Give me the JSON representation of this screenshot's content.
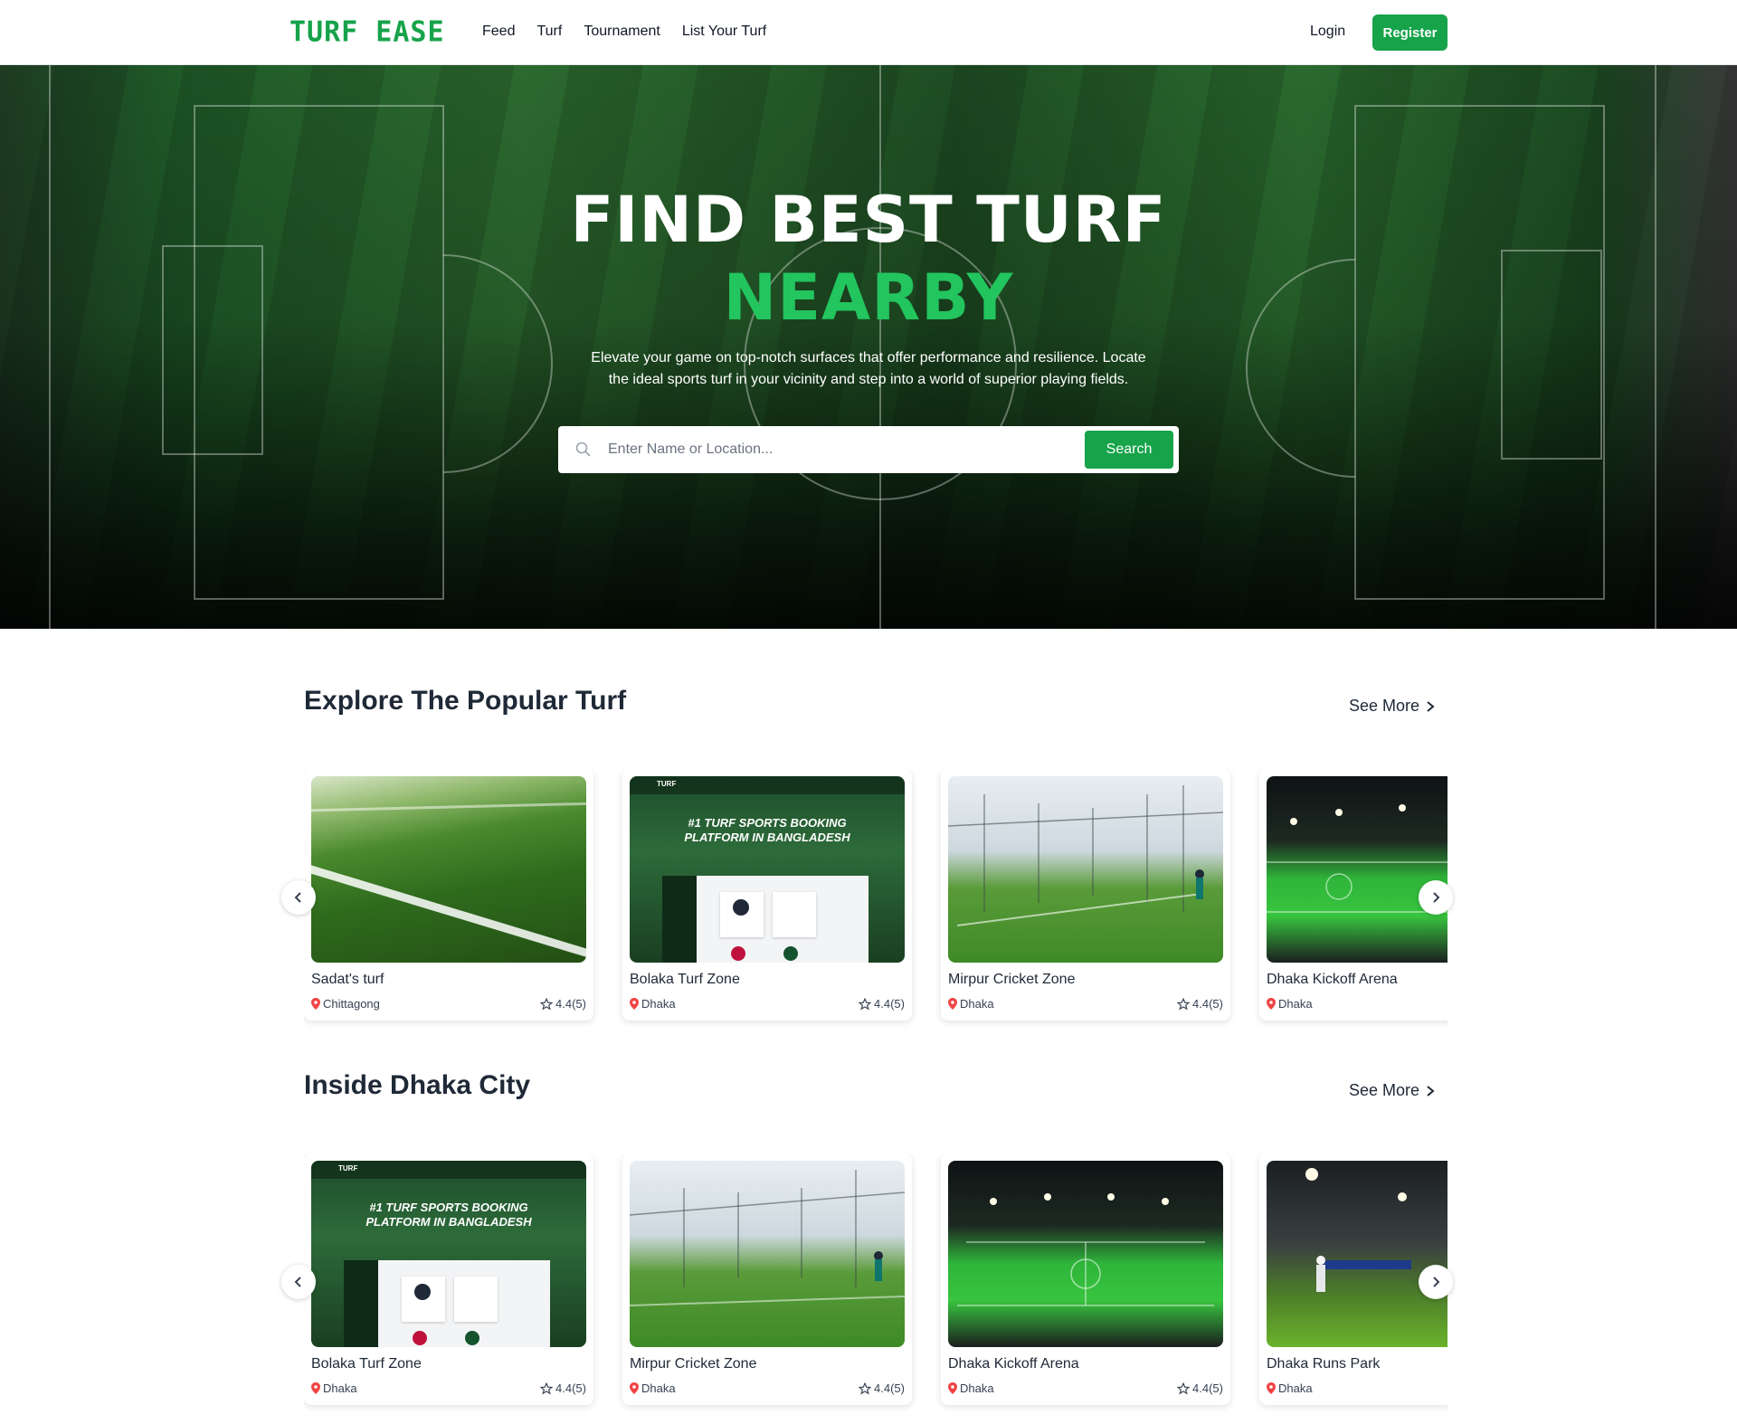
{
  "nav": {
    "logo": "TURF EASE",
    "links": [
      "Feed",
      "Turf",
      "Tournament",
      "List Your Turf"
    ],
    "login": "Login",
    "register": "Register"
  },
  "hero": {
    "title": "FIND BEST TURF",
    "subtitle": "NEARBY",
    "description": "Elevate your game on top-notch surfaces that offer performance and resilience. Locate the ideal sports turf in your vicinity and step into a world of superior playing fields.",
    "search_placeholder": "Enter Name or Location...",
    "search_button": "Search"
  },
  "sections": [
    {
      "title": "Explore The Popular Turf",
      "see_more": "See More",
      "cards": [
        {
          "name": "Sadat's turf",
          "location": "Chittagong",
          "rating": "4.4(5)",
          "image": "grass-closeup"
        },
        {
          "name": "Bolaka Turf Zone",
          "location": "Dhaka",
          "rating": "4.4(5)",
          "image": "website-screenshot"
        },
        {
          "name": "Mirpur Cricket Zone",
          "location": "Dhaka",
          "rating": "4.4(5)",
          "image": "cricket-nets"
        },
        {
          "name": "Dhaka Kickoff Arena",
          "location": "Dhaka",
          "rating": "",
          "image": "night-arena"
        }
      ]
    },
    {
      "title": "Inside Dhaka City",
      "see_more": "See More",
      "cards": [
        {
          "name": "Bolaka Turf Zone",
          "location": "Dhaka",
          "rating": "4.4(5)",
          "image": "website-screenshot"
        },
        {
          "name": "Mirpur Cricket Zone",
          "location": "Dhaka",
          "rating": "4.4(5)",
          "image": "cricket-nets"
        },
        {
          "name": "Dhaka Kickoff Arena",
          "location": "Dhaka",
          "rating": "4.4(5)",
          "image": "night-arena"
        },
        {
          "name": "Dhaka Runs Park",
          "location": "Dhaka",
          "rating": "",
          "image": "night-cricket"
        }
      ]
    }
  ],
  "screenshot_text": {
    "line1": "#1 TURF SPORTS BOOKING",
    "line2": "PLATFORM IN BANGLADESH",
    "brand": "TURF"
  },
  "colors": {
    "accent": "#16a34a",
    "hero_highlight": "#22c55e",
    "pin": "#ef4444"
  }
}
